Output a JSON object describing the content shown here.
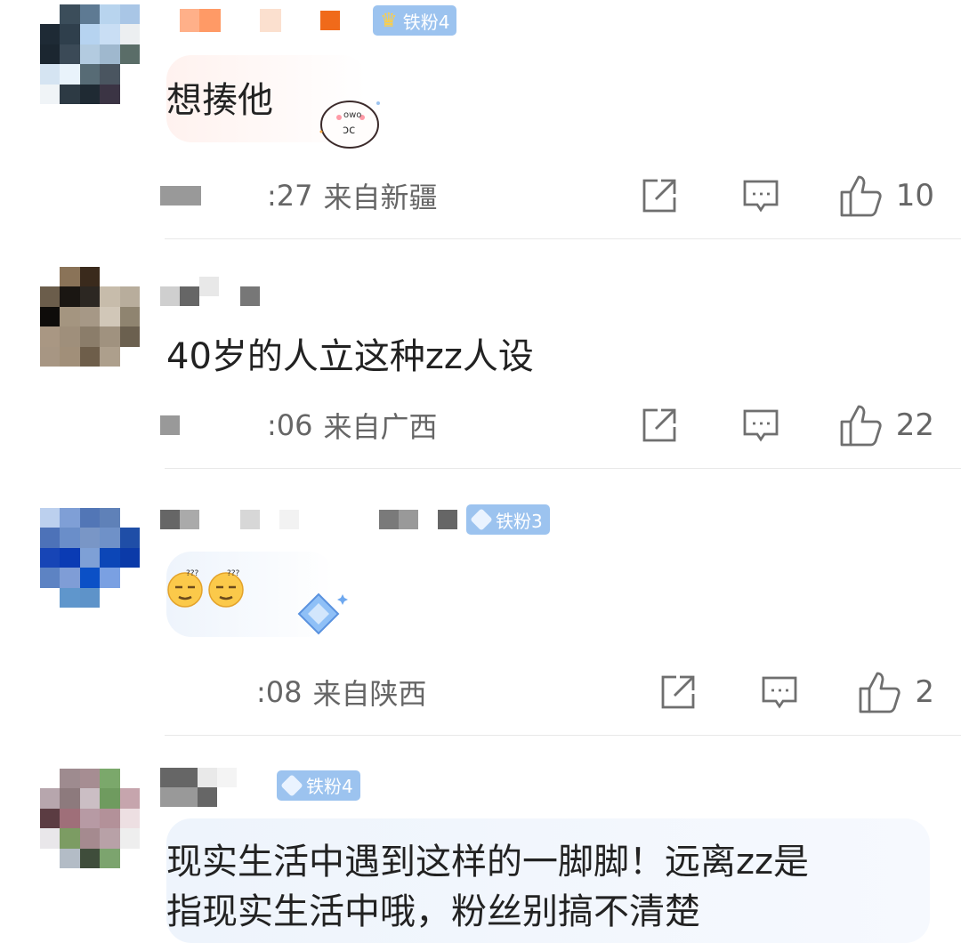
{
  "comments": [
    {
      "badge": "铁粉4",
      "badge_type": "crown",
      "text": "想揍他",
      "time": ":27",
      "location": "来自新疆",
      "likes": "10",
      "avatar_colors": [
        "#ffffff",
        "#3b4d5a",
        "#5e7a93",
        "#b8d4ee",
        "#a9c6e6",
        "#1e2a35",
        "#2f3f4c",
        "#b6d3f0",
        "#c9def4",
        "#eceff1",
        "#1b2630",
        "#3b4a57",
        "#b3cbe0",
        "#9fb8ce",
        "#5a6d68",
        "#d5e4f2",
        "#e9f3fb",
        "#576b75",
        "#4a5560",
        "#ffffff",
        "#f0f4f7",
        "#2d3a44",
        "#1f2a33",
        "#3b3444",
        "#ffffff"
      ]
    },
    {
      "badge": "",
      "badge_type": "none",
      "text": "40岁的人立这种zz人设",
      "time": ":06",
      "location": "来自广西",
      "likes": "22",
      "avatar_colors": [
        "#ffffff",
        "#8a7358",
        "#3a2a1c",
        "#ffffff",
        "#ffffff",
        "#6b5d4b",
        "#1a1612",
        "#2c2722",
        "#c7bcab",
        "#b8ad9c",
        "#0e0c0a",
        "#a49580",
        "#a69886",
        "#d1c7b8",
        "#8f8470",
        "#a99783",
        "#9f8f7b",
        "#8b7d6a",
        "#a0927f",
        "#6b604f",
        "#a79683",
        "#a18f79",
        "#6e5e4a",
        "#ad9f8c",
        "#ffffff"
      ]
    },
    {
      "badge": "铁粉3",
      "badge_type": "gem",
      "text": "",
      "time": ":08",
      "location": "来自陕西",
      "likes": "2",
      "avatar_colors": [
        "#bcd0ee",
        "#7f9fd6",
        "#5276b6",
        "#5f81b8",
        "#ffffff",
        "#4d72b8",
        "#6a8ec9",
        "#7996c6",
        "#6f91c8",
        "#1f4ea7",
        "#1745b6",
        "#0a3bb4",
        "#7ea0d6",
        "#0c46b7",
        "#0b3aa8",
        "#5d83c3",
        "#7f9dd6",
        "#0b50c6",
        "#7aa0e2",
        "#ffffff",
        "#ffffff",
        "#5f96cc",
        "#5e93c9",
        "#ffffff",
        "#ffffff"
      ]
    },
    {
      "badge": "铁粉4",
      "badge_type": "gem",
      "text": "现实生活中遇到这样的一脚脚！远离zz是",
      "text2": "指现实生活中哦，粉丝别搞不清楚",
      "time": "",
      "location": "",
      "likes": "",
      "avatar_colors": [
        "#ffffff",
        "#9e8b8f",
        "#a68d92",
        "#7ba86b",
        "#ffffff",
        "#b7a6ad",
        "#8d7a7d",
        "#cbbec4",
        "#6f9b5f",
        "#c6a5ad",
        "#5b3c42",
        "#9f6f79",
        "#b79aa4",
        "#b39199",
        "#eddfe2",
        "#e9e7ea",
        "#7c9c63",
        "#a58a8f",
        "#b8a1a7",
        "#eeeeee",
        "#ffffff",
        "#b3bcc6",
        "#3f4d3b",
        "#7ca46e",
        "#ffffff"
      ]
    }
  ],
  "colors": {
    "badge_bg": "#9cc3ef",
    "meta_text": "#666666",
    "icon_stroke": "#6f6f6f",
    "divider": "#e8e8e8"
  },
  "icons": [
    "share-icon",
    "comment-icon",
    "like-icon",
    "crown-icon",
    "gem-icon"
  ]
}
